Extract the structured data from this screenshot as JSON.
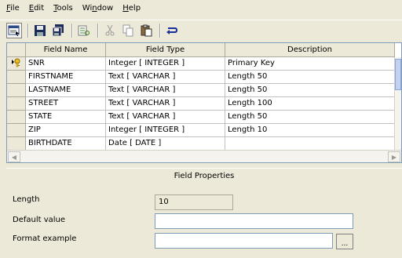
{
  "menu": [
    {
      "label": "File",
      "key": "F",
      "rest": "ile"
    },
    {
      "label": "Edit",
      "key": "E",
      "rest": "dit"
    },
    {
      "label": "Tools",
      "key": "T",
      "rest": "ools"
    },
    {
      "label": "Window",
      "pre": "Wi",
      "key": "n",
      "rest": "dow"
    },
    {
      "label": "Help",
      "key": "H",
      "rest": "elp"
    }
  ],
  "toolbar": {
    "icons": [
      "design-view-icon",
      "save-icon",
      "save-all-icon",
      "primary-key-icon",
      "cut-icon",
      "copy-icon",
      "paste-icon",
      "return-icon"
    ]
  },
  "grid": {
    "columns": [
      "Field Name",
      "Field Type",
      "Description"
    ],
    "rows": [
      {
        "name": "SNR",
        "type": "Integer [ INTEGER ]",
        "description": "Primary Key",
        "primary_key": true
      },
      {
        "name": "FIRSTNAME",
        "type": "Text [ VARCHAR ]",
        "description": "Length 50"
      },
      {
        "name": "LASTNAME",
        "type": "Text [ VARCHAR ]",
        "description": "Length 50"
      },
      {
        "name": "STREET",
        "type": "Text [ VARCHAR ]",
        "description": "Length 100"
      },
      {
        "name": "STATE",
        "type": "Text [ VARCHAR ]",
        "description": "Length 50"
      },
      {
        "name": "ZIP",
        "type": "Integer [ INTEGER ]",
        "description": "Length 10"
      },
      {
        "name": "BIRTHDATE",
        "type": "Date [ DATE ]",
        "description": ""
      }
    ]
  },
  "field_properties": {
    "title": "Field Properties",
    "length_label": "Length",
    "length_value": "10",
    "default_label": "Default value",
    "default_value": "",
    "format_label": "Format example",
    "format_value": "",
    "format_button": "..."
  },
  "colors": {
    "background": "#ece9d8",
    "grid_border": "#7f9db9",
    "key_icon": "#d4a017"
  }
}
